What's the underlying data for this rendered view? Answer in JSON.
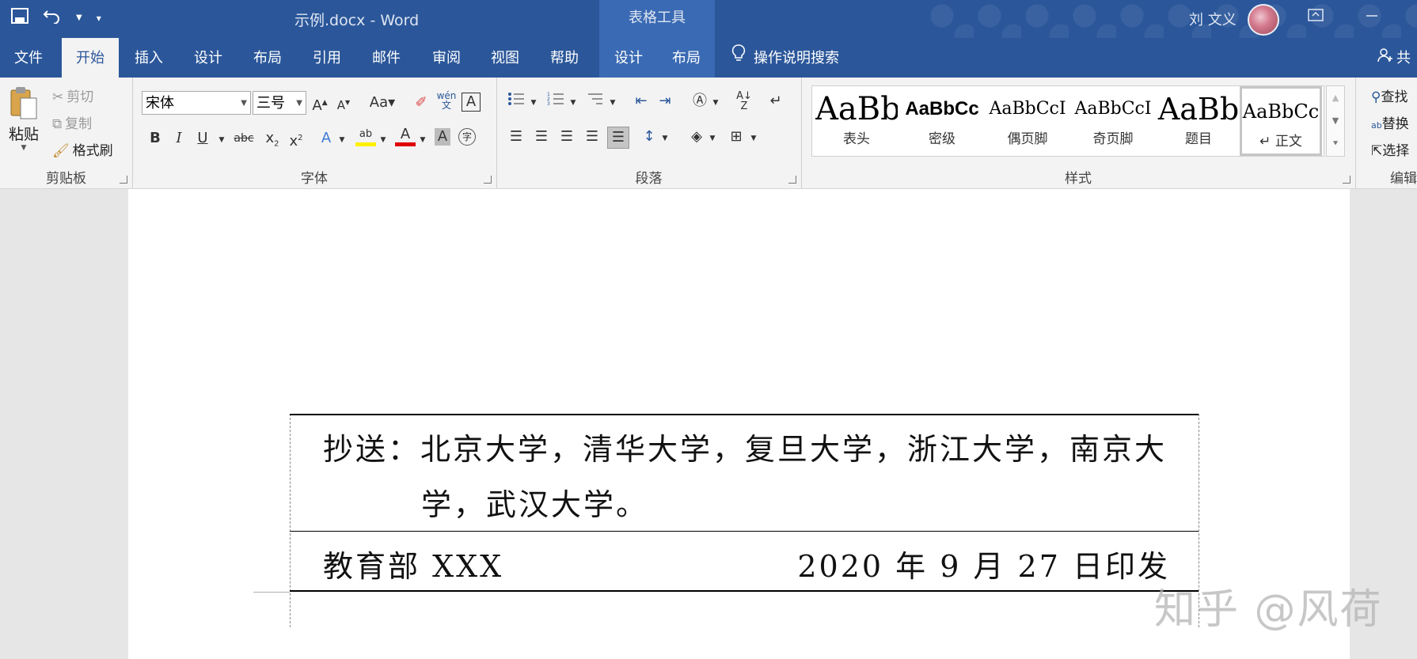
{
  "titlebar": {
    "doc_title": "示例.docx  -  Word",
    "table_tools": "表格工具",
    "user_name": "刘 文义"
  },
  "tabs": [
    {
      "label": "文件"
    },
    {
      "label": "开始"
    },
    {
      "label": "插入"
    },
    {
      "label": "设计"
    },
    {
      "label": "布局"
    },
    {
      "label": "引用"
    },
    {
      "label": "邮件"
    },
    {
      "label": "审阅"
    },
    {
      "label": "视图"
    },
    {
      "label": "帮助"
    },
    {
      "label": "设计"
    },
    {
      "label": "布局"
    }
  ],
  "tell_me": "操作说明搜索",
  "share_label": "共",
  "clipboard": {
    "paste": "粘贴",
    "cut": "剪切",
    "copy": "复制",
    "format_painter": "格式刷",
    "label": "剪贴板"
  },
  "font": {
    "name": "宋体",
    "size": "三号",
    "label": "字体"
  },
  "paragraph": {
    "label": "段落"
  },
  "styles": {
    "label": "样式",
    "items": [
      {
        "preview": "AaBb",
        "name": "表头"
      },
      {
        "preview": "AaBbCc",
        "name": "密级"
      },
      {
        "preview": "AaBbCcI",
        "name": "偶页脚"
      },
      {
        "preview": "AaBbCcI",
        "name": "奇页脚"
      },
      {
        "preview": "AaBb",
        "name": "题目"
      },
      {
        "preview": "AaBbCc",
        "name": "↵ 正文"
      }
    ]
  },
  "editing": {
    "find": "查找",
    "replace": "替换",
    "select": "选择",
    "label": "编辑"
  },
  "document": {
    "row1_line1": "抄送：北京大学，清华大学，复旦大学，浙江大学，南京大",
    "row1_line2": "学，武汉大学。",
    "row2_left": "教育部 XXX",
    "row2_right": "2020 年 9 月 27 日印发"
  },
  "watermark": "知乎 @风荷",
  "colors": {
    "title_bar": "#2b579a",
    "context_tab": "#3a6ab3",
    "ribbon_bg": "#f3f3f3"
  }
}
